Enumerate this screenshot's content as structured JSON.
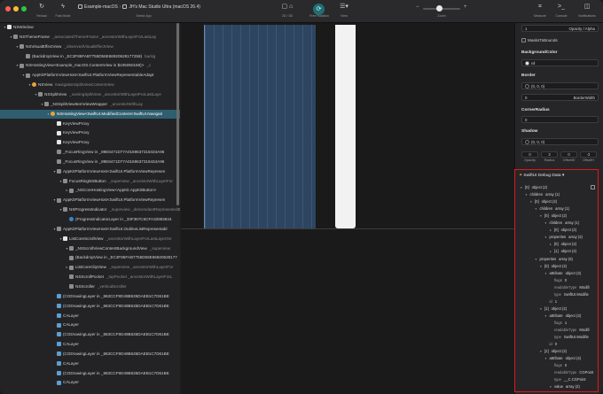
{
  "colors": {
    "accent_selected": "#2f5e70",
    "debug_border": "#e01818",
    "rotation_button": "#1d6f73"
  },
  "toolbar": {
    "reload_label": "Reload",
    "fast_mode_label": "Fast Mode",
    "scheme": "Example-macOS",
    "scheme_sep": "›",
    "device": "JH's Mac Studio Ultra (macOS 26.4)",
    "select_app_label": "Select App",
    "mode_label": "2D / 3D",
    "free_rotation_label": "Free Rotation",
    "view_label": "View",
    "zoom_label": "Zoom",
    "measure_label": "Measure",
    "console_label": "Console",
    "notifications_label": "Notifications",
    "zoom_minus": "−",
    "zoom_plus": "+",
    "zoom_level": 0.45
  },
  "tree": {
    "rows": [
      {
        "indent": 0,
        "disc": "▾",
        "icon": "white",
        "name": "NSWindow",
        "dim": ""
      },
      {
        "indent": 1,
        "disc": "▾",
        "icon": "gray",
        "name": "NSThemeFrame",
        "dim": "_associatedThemeFrame  _ancestorWithLayerForLastLay"
      },
      {
        "indent": 2,
        "disc": "▾",
        "icon": "gray",
        "name": "NSVisualEffectView",
        "dim": "_observedVisualEffectView"
      },
      {
        "indent": 3,
        "disc": "",
        "icon": "gray",
        "name": "(BackdropView in _EC3F85FAB7755D56E66920628177258)",
        "dim": "backg"
      },
      {
        "indent": 2,
        "disc": "▾",
        "icon": "gray",
        "name": "NSHostingView<Example_macOS.ContentView in $105050158)>",
        "dim": "_c"
      },
      {
        "indent": 3,
        "disc": "▾",
        "icon": "gray",
        "name": "AppKitPlatformViewHost<SwiftUI.PlatformViewRepresentableAdapt",
        "dim": ""
      },
      {
        "indent": 4,
        "disc": "▾",
        "icon": "orange",
        "name": "NSView",
        "dim": "NavigationSplitViewContentView"
      },
      {
        "indent": 5,
        "disc": "▾",
        "icon": "gray",
        "name": "NSSplitView",
        "dim": "_owningSplitView  _ancestorWithLayerForLastLaye"
      },
      {
        "indent": 6,
        "disc": "▾",
        "icon": "gray",
        "name": "_NSSplitViewItemViewWrapper",
        "dim": "_ancestorWithLay"
      },
      {
        "indent": 7,
        "disc": "▾",
        "icon": "orange",
        "name": "NSHostingView<SwiftUI.ModifiedContent<SwiftUI.Navigati",
        "dim": "",
        "selected": true
      },
      {
        "indent": 8,
        "disc": "",
        "icon": "white",
        "name": "KeyViewProxy",
        "dim": ""
      },
      {
        "indent": 8,
        "disc": "",
        "icon": "white",
        "name": "KeyViewProxy",
        "dim": ""
      },
      {
        "indent": 8,
        "disc": "",
        "icon": "white",
        "name": "KeyViewProxy",
        "dim": ""
      },
      {
        "indent": 8,
        "disc": "",
        "icon": "gray",
        "name": "_FocusRingView in _89E6471D77A0169637318434A96",
        "dim": ""
      },
      {
        "indent": 8,
        "disc": "",
        "icon": "gray",
        "name": "_FocusRingView in _89E6471D77A0169637318434A96",
        "dim": ""
      },
      {
        "indent": 8,
        "disc": "▾",
        "icon": "gray",
        "name": "AppKitPlatformViewHost<SwiftUI.PlatformViewRepresen",
        "dim": ""
      },
      {
        "indent": 9,
        "disc": "▾",
        "icon": "gray",
        "name": "FocusRingNSButton",
        "dim": "_superview  _ancestorWithLayerFor"
      },
      {
        "indent": 10,
        "disc": "▸",
        "icon": "gray",
        "name": "_NSCoreHostingView<AppKit.AppKitButton>",
        "dim": ""
      },
      {
        "indent": 8,
        "disc": "▾",
        "icon": "gray",
        "name": "AppKitPlatformViewHost<SwiftUI.PlatformViewRepresen",
        "dim": ""
      },
      {
        "indent": 9,
        "disc": "▾",
        "icon": "gray",
        "name": "NSProgressIndicator",
        "dim": "_superview  _descendantRepresentedBy"
      },
      {
        "indent": 10,
        "disc": "",
        "icon": "blue",
        "name": "(ProgressIndicatorLayer in _33F367C6CFA32863844",
        "dim": ""
      },
      {
        "indent": 8,
        "disc": "▾",
        "icon": "gray",
        "name": "AppKitPlatformViewHost<SwiftUI.OutlineListRepresentabl",
        "dim": ""
      },
      {
        "indent": 9,
        "disc": "▾",
        "icon": "white",
        "name": "ListCoreScrollView",
        "dim": "_ancestorWithLayerForLastLayerGe"
      },
      {
        "indent": 10,
        "disc": "▾",
        "icon": "gray",
        "name": "_NSScrollViewContentBackgroundView",
        "dim": "_superview"
      },
      {
        "indent": 10,
        "disc": "",
        "icon": "gray",
        "name": "(BackdropView in _EC3F85FAB7755D56E66920628177",
        "dim": ""
      },
      {
        "indent": 10,
        "disc": "▸",
        "icon": "gray",
        "name": "ListCoreClipView",
        "dim": "_superview  _ancestorWithLayerFor"
      },
      {
        "indent": 10,
        "disc": "",
        "icon": "gray",
        "name": "NSScrollPocket",
        "dim": "_topPocket  _ancestorWithLayerForL"
      },
      {
        "indent": 10,
        "disc": "",
        "icon": "gray",
        "name": "NSScroller",
        "dim": "_verticalScroller"
      },
      {
        "indent": 8,
        "disc": "",
        "icon": "layer",
        "name": "(CGDrawingLayer in _863CCF9D49B535DAEB1C7D61BE",
        "dim": ""
      },
      {
        "indent": 8,
        "disc": "",
        "icon": "layer",
        "name": "(CGDrawingLayer in _863CCF9D49B535DAEB1C7D61BE",
        "dim": ""
      },
      {
        "indent": 8,
        "disc": "",
        "icon": "layer",
        "name": "CALayer",
        "dim": ""
      },
      {
        "indent": 8,
        "disc": "",
        "icon": "layer",
        "name": "CALayer",
        "dim": ""
      },
      {
        "indent": 8,
        "disc": "",
        "icon": "layer",
        "name": "(CGDrawingLayer in _863CCF9D49B535DAEB1C7D61BE",
        "dim": ""
      },
      {
        "indent": 8,
        "disc": "",
        "icon": "layer",
        "name": "CALayer",
        "dim": ""
      },
      {
        "indent": 8,
        "disc": "",
        "icon": "layer",
        "name": "(CGDrawingLayer in _863CCF9D49B535DAEB1C7D61BE",
        "dim": ""
      },
      {
        "indent": 8,
        "disc": "",
        "icon": "layer",
        "name": "CALayer",
        "dim": ""
      },
      {
        "indent": 8,
        "disc": "",
        "icon": "layer",
        "name": "(CGDrawingLayer in _863CCF9D49B535DAEB1C7D61BE",
        "dim": ""
      },
      {
        "indent": 8,
        "disc": "",
        "icon": "layer",
        "name": "CALayer",
        "dim": ""
      }
    ]
  },
  "inspector": {
    "opacity_field": "1",
    "opacity_alpha_label": "Opacity / Alpha",
    "masks_to_bounds_label": "MasksToBounds",
    "background_color_label": "BackgroundColor",
    "background_color_value": "nil",
    "border_label": "Border",
    "border_color_value": "(0, 0, 0)",
    "border_width_value": "0",
    "border_width_label": "BorderWidth",
    "corner_radius_label": "CornerRadius",
    "corner_radius_value": "0",
    "shadow_label": "Shadow",
    "shadow_color_value": "(0, 0, 0)",
    "shadow_fields": [
      {
        "value": "0",
        "label": "Opacity"
      },
      {
        "value": "3",
        "label": "Radius"
      },
      {
        "value": "0",
        "label": "OffsetW"
      },
      {
        "value": "-3",
        "label": "OffsetH"
      }
    ]
  },
  "debug": {
    "title": "SwiftUI Debug Data",
    "title_caret": "▾",
    "rows": [
      {
        "indent": 0,
        "tri": "▾",
        "k": "[0]",
        "v": "object (2)"
      },
      {
        "indent": 1,
        "tri": "▾",
        "k": "children",
        "v": "array (1)"
      },
      {
        "indent": 2,
        "tri": "▾",
        "k": "[0]",
        "v": "object (2)"
      },
      {
        "indent": 3,
        "tri": "▾",
        "k": "children",
        "v": "array (1)"
      },
      {
        "indent": 4,
        "tri": "▾",
        "k": "[0]",
        "v": "object (2)"
      },
      {
        "indent": 5,
        "tri": "▾",
        "k": "children",
        "v": "array (1)"
      },
      {
        "indent": 6,
        "tri": "▸",
        "k": "[0]",
        "v": "object (2)"
      },
      {
        "indent": 5,
        "tri": "▾",
        "k": "properties",
        "v": "array (2)"
      },
      {
        "indent": 6,
        "tri": "▸",
        "k": "[0]",
        "v": "object (2)"
      },
      {
        "indent": 6,
        "tri": "▸",
        "k": "[1]",
        "v": "object (2)"
      },
      {
        "indent": 3,
        "tri": "▾",
        "k": "properties",
        "v": "array (5)"
      },
      {
        "indent": 4,
        "tri": "▾",
        "k": "[0]",
        "v": "object (2)"
      },
      {
        "indent": 5,
        "tri": "▾",
        "k": "attribute",
        "v": "object (3)"
      },
      {
        "indent": 6,
        "tri": "",
        "k": "flags",
        "v": "0",
        "plain": true
      },
      {
        "indent": 6,
        "tri": "",
        "k": "readableType",
        "v": "Modifi",
        "plain": true
      },
      {
        "indent": 6,
        "tri": "",
        "k": "type",
        "v": "SwiftUI.Modifie",
        "plain": true
      },
      {
        "indent": 5,
        "tri": "",
        "k": "id",
        "v": "1",
        "plain": true
      },
      {
        "indent": 4,
        "tri": "▾",
        "k": "[1]",
        "v": "object (2)"
      },
      {
        "indent": 5,
        "tri": "▾",
        "k": "attribute",
        "v": "object (3)"
      },
      {
        "indent": 6,
        "tri": "",
        "k": "flags",
        "v": "1",
        "plain": true
      },
      {
        "indent": 6,
        "tri": "",
        "k": "readableType",
        "v": "Modifi",
        "plain": true
      },
      {
        "indent": 6,
        "tri": "",
        "k": "type",
        "v": "SwiftUI.Modifie",
        "plain": true
      },
      {
        "indent": 5,
        "tri": "",
        "k": "id",
        "v": "0",
        "plain": true
      },
      {
        "indent": 4,
        "tri": "▾",
        "k": "[2]",
        "v": "object (2)"
      },
      {
        "indent": 5,
        "tri": "▾",
        "k": "attribute",
        "v": "object (4)"
      },
      {
        "indent": 6,
        "tri": "",
        "k": "flags",
        "v": "0",
        "plain": true
      },
      {
        "indent": 6,
        "tri": "",
        "k": "readableType",
        "v": "CGPoint",
        "plain": true
      },
      {
        "indent": 6,
        "tri": "",
        "k": "type",
        "v": "__C.CGPoint",
        "plain": true
      },
      {
        "indent": 6,
        "tri": "▾",
        "k": "value",
        "v": "array (2)"
      },
      {
        "indent": 7,
        "tri": "",
        "k": "[0]",
        "v": "209",
        "plain": true
      }
    ]
  }
}
